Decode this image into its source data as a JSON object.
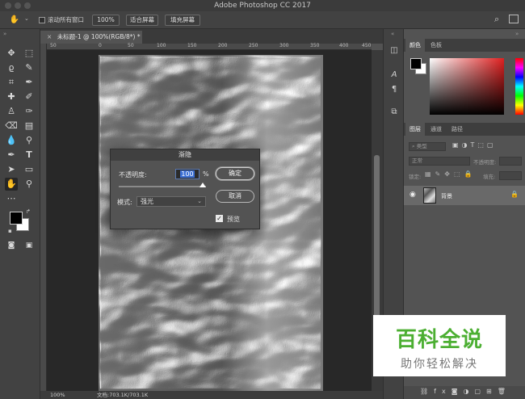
{
  "window": {
    "title": "Adobe Photoshop CC 2017"
  },
  "options_bar": {
    "scroll_all_windows_label": "滚动所有窗口",
    "zoom_100_label": "100%",
    "fit_screen_label": "适合屏幕",
    "fill_screen_label": "填充屏幕"
  },
  "document": {
    "tab_label": "未标题-1 @ 100%(RGB/8*) *",
    "ruler_labels": [
      "50",
      "0",
      "50",
      "100",
      "150",
      "200",
      "250",
      "300",
      "350",
      "400",
      "450"
    ]
  },
  "status": {
    "zoom": "100%",
    "doc_info": "文档:703.1K/703.1K"
  },
  "color_panel": {
    "tab_color": "颜色",
    "tab_swatches": "色板"
  },
  "layers_panel": {
    "tab_layers": "图层",
    "tab_channels": "通道",
    "tab_paths": "路径",
    "kind_filter": "类型",
    "blend_mode": "正常",
    "opacity_label": "不透明度:",
    "lock_label": "锁定:",
    "fill_label": "填充:",
    "layer_name": "背景"
  },
  "fade_dialog": {
    "title": "渐隐",
    "opacity_label": "不透明度:",
    "opacity_value": "100",
    "percent": "%",
    "mode_label": "模式:",
    "mode_value": "强光",
    "ok_label": "确定",
    "cancel_label": "取消",
    "preview_label": "预览",
    "preview_checked": true
  },
  "watermark": {
    "title": "百科全说",
    "subtitle": "助你轻松解决"
  },
  "colors": {
    "accent_green": "#4caf32",
    "selection_blue": "#3b6fd4",
    "fg_swatch": "#000000",
    "bg_swatch": "#ffffff"
  }
}
